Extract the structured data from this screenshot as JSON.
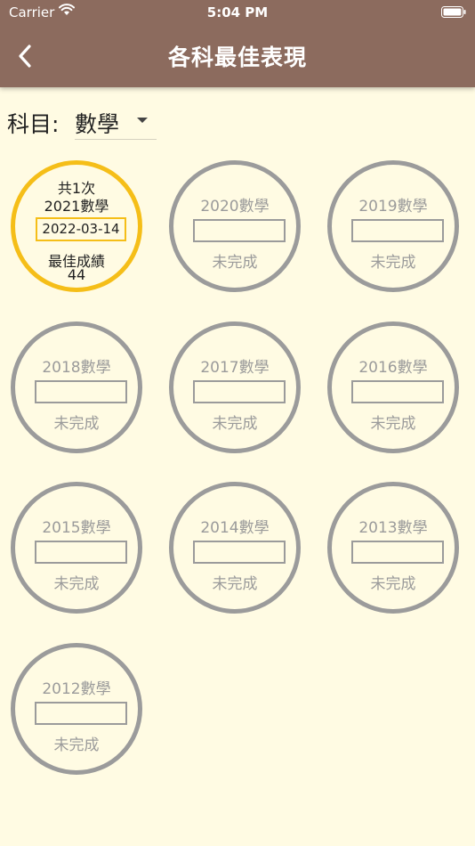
{
  "status_bar": {
    "carrier": "Carrier",
    "time": "5:04 PM"
  },
  "header": {
    "title": "各科最佳表現"
  },
  "subject": {
    "label": "科目:",
    "value": "數學"
  },
  "active_card": {
    "count": "共1次",
    "year": "2021數學",
    "date": "2022-03-14",
    "best_label": "最佳成績",
    "score": "44"
  },
  "cards": [
    {
      "year": "2020數學",
      "status": "未完成"
    },
    {
      "year": "2019數學",
      "status": "未完成"
    },
    {
      "year": "2018數學",
      "status": "未完成"
    },
    {
      "year": "2017數學",
      "status": "未完成"
    },
    {
      "year": "2016數學",
      "status": "未完成"
    },
    {
      "year": "2015數學",
      "status": "未完成"
    },
    {
      "year": "2014數學",
      "status": "未完成"
    },
    {
      "year": "2013數學",
      "status": "未完成"
    },
    {
      "year": "2012數學",
      "status": "未完成"
    }
  ],
  "colors": {
    "header": "#8c6b5e",
    "background": "#fffbe3",
    "active_ring": "#f5be18",
    "inactive_ring": "#9b9b9b"
  }
}
